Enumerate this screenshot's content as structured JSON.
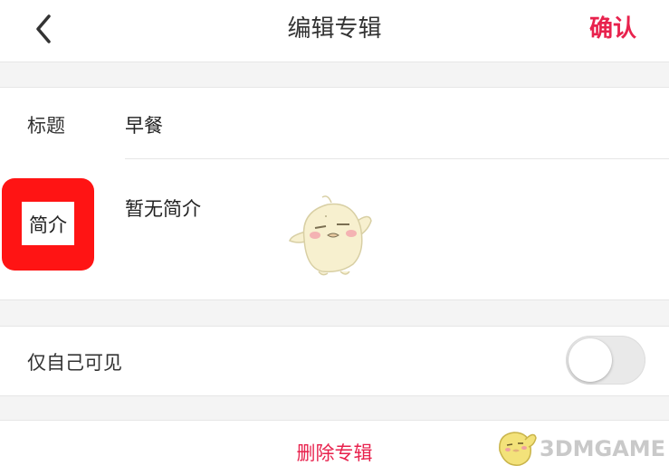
{
  "header": {
    "title": "编辑专辑",
    "confirm_label": "确认",
    "back_icon": "chevron-left-icon"
  },
  "form": {
    "title_label": "标题",
    "title_value": "早餐",
    "description_label": "简介",
    "description_value": "暂无简介"
  },
  "privacy": {
    "label": "仅自己可见",
    "enabled": false
  },
  "actions": {
    "delete_label": "删除专辑"
  },
  "watermark": {
    "text": "3DMGAME"
  },
  "colors": {
    "accent": "#e8224d",
    "highlight": "#ff1414",
    "background": "#f4f4f4",
    "card": "#ffffff"
  }
}
